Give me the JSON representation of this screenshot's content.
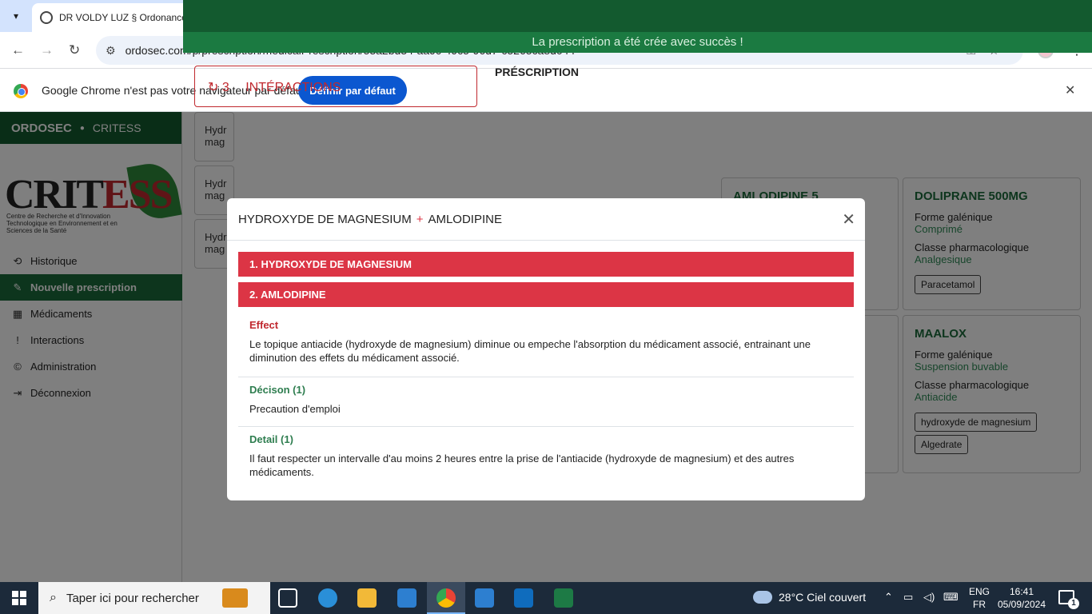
{
  "browser": {
    "tab_title": "DR VOLDY LUZ § Ordonance Sé",
    "url": "ordosec.com/p/prescription/medicalPrescription/53a2bd34-aa9c-49c5-96d7-c5265ca8d044",
    "infobar_text": "Google Chrome n'est pas votre navigateur par défaut",
    "infobar_button": "Définir par défaut"
  },
  "app": {
    "brand": "ORDOSEC",
    "brand_sub": "CRITESS",
    "logo_text_a": "CRIT",
    "logo_text_b": "ESS",
    "logo_caption": "Centre de Recherche et d'Innovation Technologique en Environnement et en Sciences de la Santé",
    "success_message": "La prescription a été crée avec succès !",
    "menu": [
      {
        "label": "Historique",
        "icon": "history-icon",
        "glyph": "⟲"
      },
      {
        "label": "Nouvelle prescription",
        "icon": "new-prescription-icon",
        "glyph": "✎"
      },
      {
        "label": "Médicaments",
        "icon": "grid-icon",
        "glyph": "▦"
      },
      {
        "label": "Interactions",
        "icon": "alert-icon",
        "glyph": "!"
      },
      {
        "label": "Administration",
        "icon": "copyright-icon",
        "glyph": "©"
      },
      {
        "label": "Déconnexion",
        "icon": "logout-icon",
        "glyph": "⇥"
      }
    ],
    "interactions_header": "INTÉRACTIONS",
    "interactions_count": "3",
    "interaction_rows": [
      "Hydr mag",
      "Hydr mag",
      "Hydr mag"
    ],
    "prescription_label": "PRÉSCRIPTION",
    "cards": [
      {
        "name": "AMLODIPINE 5",
        "form_label": "",
        "form_value": "",
        "class_label": "",
        "class_value": "",
        "chips": []
      },
      {
        "name": "DOLIPRANE 500MG",
        "form_label": "Forme galénique",
        "form_value": "Comprimé",
        "class_label": "Classe pharmacologique",
        "class_value": "Analgesique",
        "chips": [
          "Paracetamol"
        ]
      },
      {
        "name": "MAALOX",
        "form_label": "Forme galénique",
        "form_value": "Suspension buvable",
        "class_label": "Classe pharmacologique",
        "class_value": "Antiacide",
        "chips": [
          "hydroxyde de magnesium",
          "Algedrate"
        ]
      }
    ]
  },
  "modal": {
    "title_a": "HYDROXYDE DE MAGNESIUM",
    "title_plus": "+",
    "title_b": "AMLODIPINE",
    "drug_1": "1. HYDROXYDE DE MAGNESIUM",
    "drug_2": "2. AMLODIPINE",
    "effect_heading": "Effect",
    "effect_text": "Le topique antiacide (hydroxyde de magnesium) diminue ou empeche l'absorption du médicament associé, entrainant une diminution des effets du médicament associé.",
    "decision_heading": "Décison (1)",
    "decision_text": "Precaution d'emploi",
    "detail_heading": "Detail (1)",
    "detail_text": "Il faut respecter un intervalle d'au moins 2 heures entre la prise de l'antiacide (hydroxyde de magnesium) et des autres médicaments."
  },
  "taskbar": {
    "search_placeholder": "Taper ici pour rechercher",
    "weather": "28°C  Ciel couvert",
    "lang_top": "ENG",
    "lang_bottom": "FR",
    "time": "16:41",
    "date": "05/09/2024",
    "notification_count": "1"
  },
  "colors": {
    "brand_green": "#135a2f",
    "danger_red": "#dc3545",
    "chrome_blue": "#0b57d0"
  }
}
